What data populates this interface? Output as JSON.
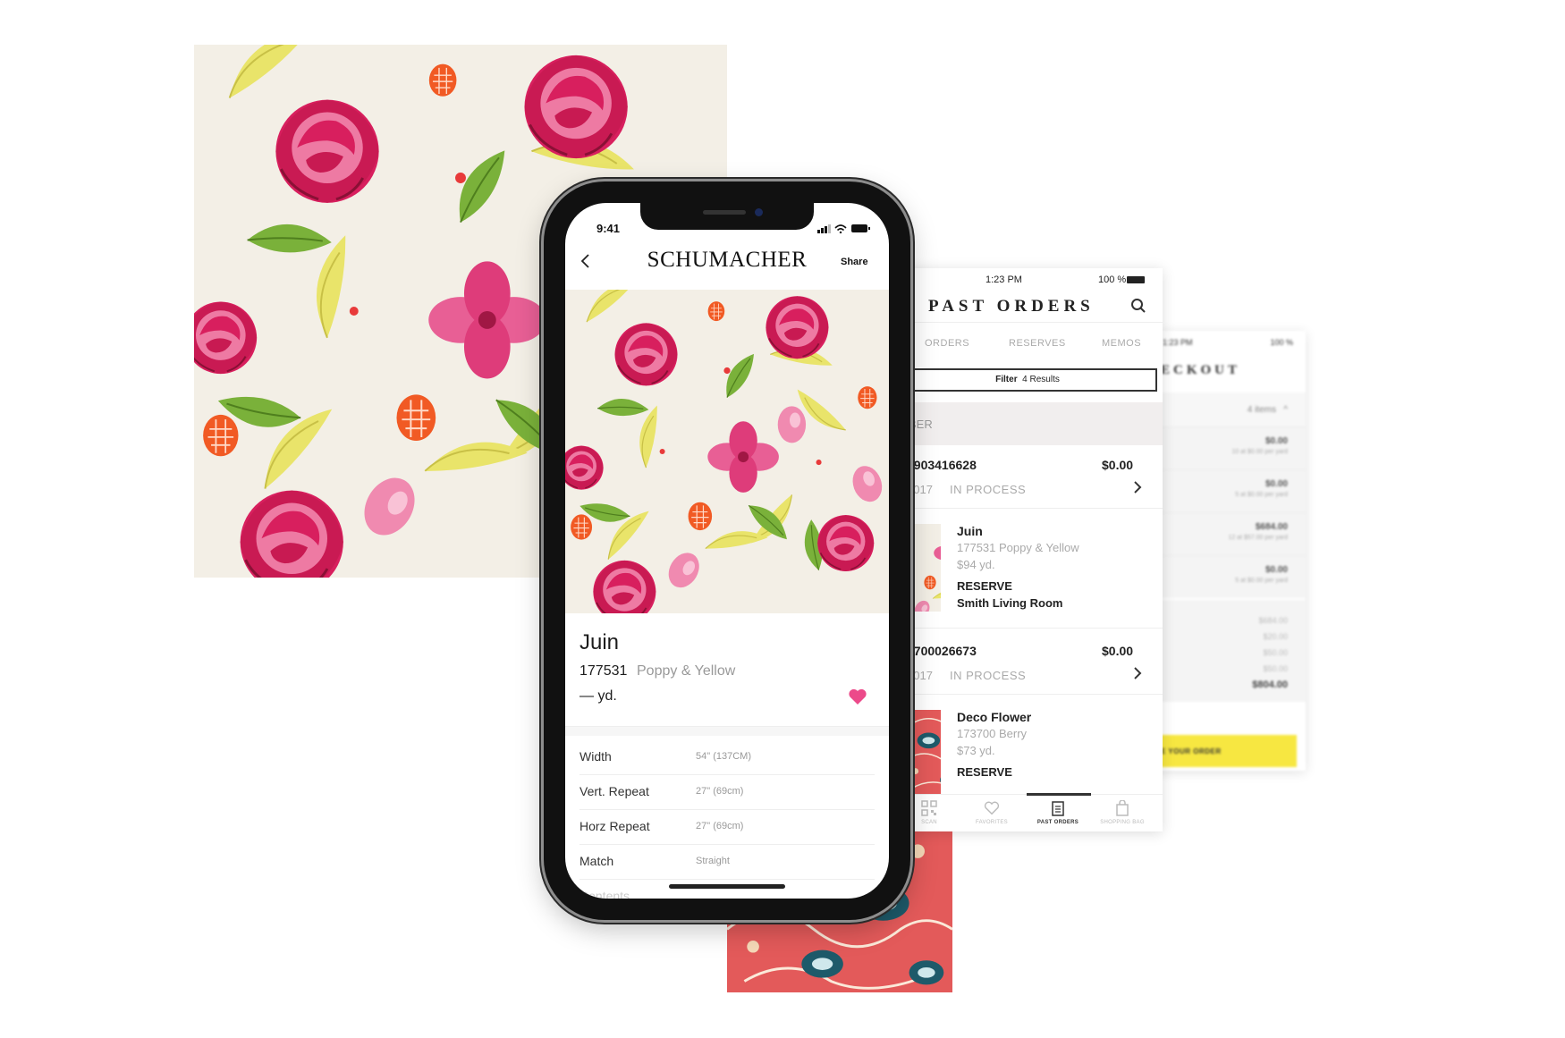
{
  "phone": {
    "status_time": "9:41",
    "brand": "SCHUMACHER",
    "share_label": "Share",
    "product": {
      "name": "Juin",
      "code": "177531",
      "color": "Poppy & Yellow",
      "price": "— yd."
    },
    "specs": [
      {
        "label": "Width",
        "value": "54\" (137CM)"
      },
      {
        "label": "Vert. Repeat",
        "value": "27\" (69cm)"
      },
      {
        "label": "Horz Repeat",
        "value": "27\" (69cm)"
      },
      {
        "label": "Match",
        "value": "Straight"
      },
      {
        "label": "Contents",
        "value": ""
      }
    ],
    "heart_color": "#ec4a8a"
  },
  "past_orders": {
    "status_time": "1:23 PM",
    "battery": "100 %",
    "title": "PAST ORDERS",
    "tabs": [
      "ORDERS",
      "RESERVES",
      "MEMOS"
    ],
    "filter_label": "Filter",
    "filter_results": "4 Results",
    "section_label": "BER",
    "orders": [
      {
        "id": "#903416628",
        "amount": "$0.00",
        "date": "2017",
        "status": "IN PROCESS",
        "item": {
          "name": "Juin",
          "code": "177531 Poppy & Yellow",
          "price": "$94 yd.",
          "type": "RESERVE",
          "room": "Smith Living Room"
        }
      },
      {
        "id": "#700026673",
        "amount": "$0.00",
        "date": "2017",
        "status": "IN PROCESS",
        "item": {
          "name": "Deco Flower",
          "code": "173700 Berry",
          "price": "$73 yd.",
          "type": "RESERVE",
          "room": ""
        }
      }
    ],
    "nav": [
      {
        "label": "SCAN",
        "icon": "qr-icon"
      },
      {
        "label": "FAVORITES",
        "icon": "heart-outline-icon"
      },
      {
        "label": "PAST ORDERS",
        "icon": "clipboard-icon"
      },
      {
        "label": "SHOPPING BAG",
        "icon": "bag-icon"
      }
    ]
  },
  "checkout": {
    "status_time": "1:23 PM",
    "battery": "100 %",
    "title": "ECKOUT",
    "items_count": "4 items",
    "lines": [
      {
        "amount": "$0.00",
        "sub": "10 at $0.00 per yard"
      },
      {
        "amount": "$0.00",
        "sub": "5 at $0.00 per yard"
      },
      {
        "amount": "$684.00",
        "sub": "12 at $57.00 per yard"
      },
      {
        "amount": "$0.00",
        "sub": "5 at $0.00 per yard"
      }
    ],
    "totals": [
      "$684.00",
      "$20.00",
      "$50.00",
      "$50.00"
    ],
    "grand_total": "$804.00",
    "place_label": "E YOUR ORDER"
  },
  "colors": {
    "accent_pink": "#d81f5e",
    "checkout_yellow": "#f7e741",
    "background": "#ffffff"
  }
}
